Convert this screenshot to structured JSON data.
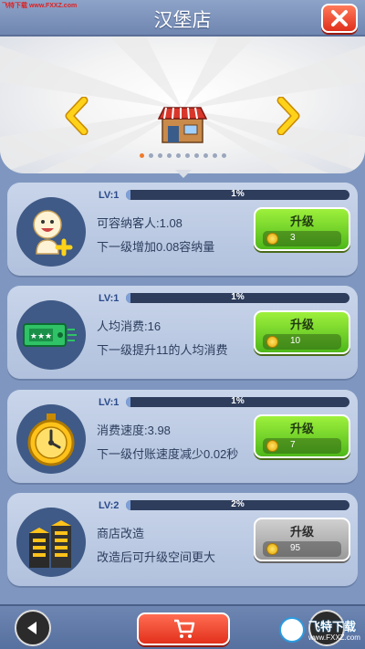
{
  "watermark_top": "飞特下载 www.FXXZ.com",
  "header": {
    "title": "汉堡店"
  },
  "banner": {
    "page_count": 10,
    "active_page": 0
  },
  "cards": [
    {
      "icon": "smiling-customer-plus-icon",
      "level": "LV:1",
      "progress": 0.01,
      "progress_text": "1%",
      "line1": "可容纳客人:1.08",
      "line2": "下一级增加0.08容纳量",
      "button_label": "升级",
      "price": "3",
      "button_state": "enabled"
    },
    {
      "icon": "ticket-icon",
      "level": "LV:1",
      "progress": 0.01,
      "progress_text": "1%",
      "line1": "人均消费:16",
      "line2": "下一级提升11的人均消费",
      "button_label": "升级",
      "price": "10",
      "button_state": "enabled"
    },
    {
      "icon": "stopwatch-icon",
      "level": "LV:1",
      "progress": 0.01,
      "progress_text": "1%",
      "line1": "消费速度:3.98",
      "line2": "下一级付账速度减少0.02秒",
      "button_label": "升级",
      "price": "7",
      "button_state": "enabled"
    },
    {
      "icon": "buildings-icon",
      "level": "LV:2",
      "progress": 0.02,
      "progress_text": "2%",
      "line1": "商店改造",
      "line2": "改造后可升级空间更大",
      "button_label": "升级",
      "price": "95",
      "button_state": "disabled"
    }
  ],
  "watermark_bottom": {
    "title": "飞特下载",
    "url": "www.FXXZ.com"
  },
  "colors": {
    "accent_green": "#4eb81a",
    "accent_red": "#e0301c",
    "card_bg": "#c9d5ea",
    "background": "#7f97c0"
  }
}
